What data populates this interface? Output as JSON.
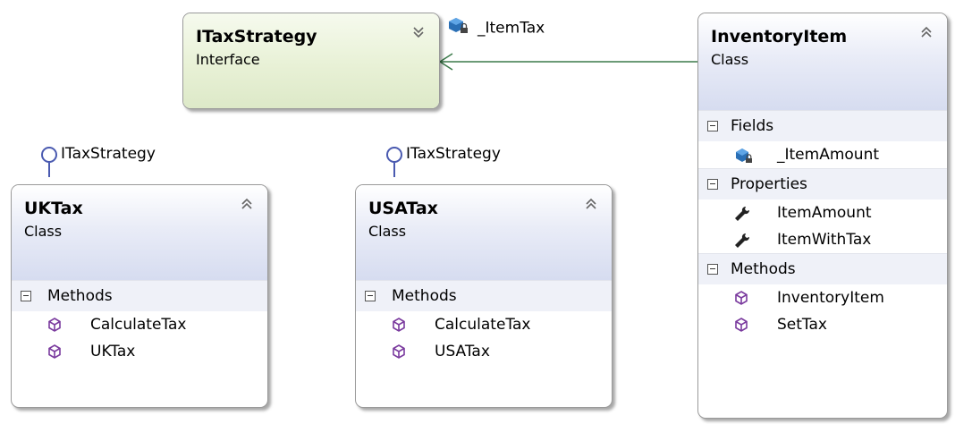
{
  "colors": {
    "interface_header": "#e8f1d6",
    "class_header": "#dde2f4",
    "method_icon": "#7a3a9e",
    "field_icon": "#2a6fb5",
    "association_line": "#3b7a4a",
    "lollipop": "#4a5ab0"
  },
  "itaxstrategy": {
    "title": "ITaxStrategy",
    "kind": "Interface",
    "toggle_icon": "chevron-double-down-icon"
  },
  "association": {
    "label": "_ItemTax",
    "icon": "private-field-icon"
  },
  "inventory": {
    "title": "InventoryItem",
    "kind": "Class",
    "toggle_icon": "chevron-double-up-icon",
    "sections": {
      "fields": {
        "label": "Fields",
        "items": [
          "_ItemAmount"
        ]
      },
      "properties": {
        "label": "Properties",
        "items": [
          "ItemAmount",
          "ItemWithTax"
        ]
      },
      "methods": {
        "label": "Methods",
        "items": [
          "InventoryItem",
          "SetTax"
        ]
      }
    }
  },
  "uktax": {
    "title": "UKTax",
    "kind": "Class",
    "implements": "ITaxStrategy",
    "toggle_icon": "chevron-double-up-icon",
    "sections": {
      "methods": {
        "label": "Methods",
        "items": [
          "CalculateTax",
          "UKTax"
        ]
      }
    }
  },
  "usatax": {
    "title": "USATax",
    "kind": "Class",
    "implements": "ITaxStrategy",
    "toggle_icon": "chevron-double-up-icon",
    "sections": {
      "methods": {
        "label": "Methods",
        "items": [
          "CalculateTax",
          "USATax"
        ]
      }
    }
  }
}
